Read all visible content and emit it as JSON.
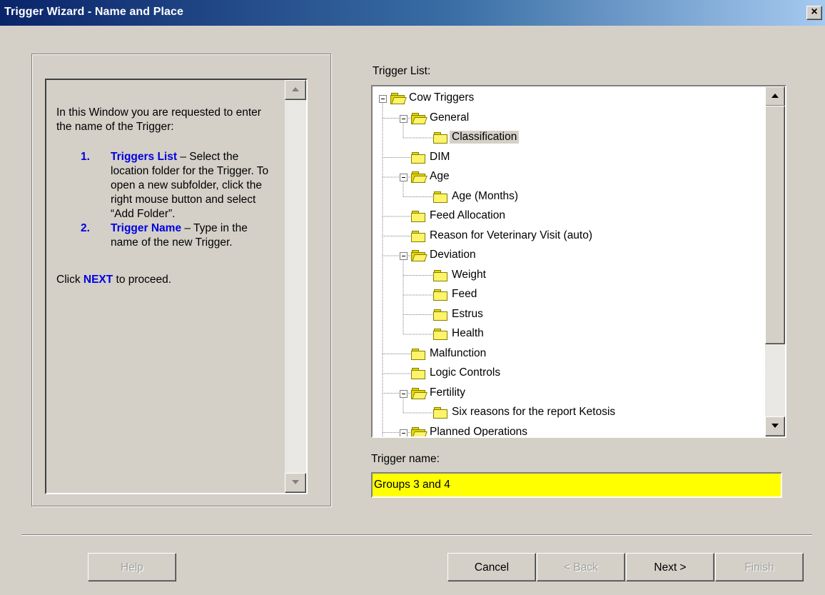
{
  "window": {
    "title": "Trigger Wizard - Name and Place",
    "close_label": "×"
  },
  "help": {
    "intro": "In this Window you are requested to enter the name of the Trigger:",
    "items": [
      {
        "num": "1.",
        "title": "Triggers List",
        "text": " – Select the location folder for the Trigger. To open a new subfolder, click the right mouse button and select “Add Folder”."
      },
      {
        "num": "2.",
        "title": "Trigger Name",
        "text": " – Type in the name of the new Trigger."
      }
    ],
    "proceed_prefix": "Click ",
    "proceed_keyword": "NEXT",
    "proceed_suffix": " to proceed."
  },
  "trigger_list": {
    "label": "Trigger List:",
    "nodes": [
      {
        "label": "Cow Triggers",
        "level": 0,
        "expanded": true,
        "selected": false
      },
      {
        "label": "General",
        "level": 1,
        "expanded": true,
        "selected": false
      },
      {
        "label": "Classification",
        "level": 2,
        "expanded": false,
        "selected": true
      },
      {
        "label": "DIM",
        "level": 1,
        "expanded": false,
        "selected": false
      },
      {
        "label": "Age",
        "level": 1,
        "expanded": true,
        "selected": false
      },
      {
        "label": "Age (Months)",
        "level": 2,
        "expanded": false,
        "selected": false
      },
      {
        "label": "Feed Allocation",
        "level": 1,
        "expanded": false,
        "selected": false
      },
      {
        "label": "Reason for Veterinary Visit (auto)",
        "level": 1,
        "expanded": false,
        "selected": false
      },
      {
        "label": "Deviation",
        "level": 1,
        "expanded": true,
        "selected": false
      },
      {
        "label": "Weight",
        "level": 2,
        "expanded": false,
        "selected": false
      },
      {
        "label": "Feed",
        "level": 2,
        "expanded": false,
        "selected": false
      },
      {
        "label": "Estrus",
        "level": 2,
        "expanded": false,
        "selected": false
      },
      {
        "label": "Health",
        "level": 2,
        "expanded": false,
        "selected": false
      },
      {
        "label": "Malfunction",
        "level": 1,
        "expanded": false,
        "selected": false
      },
      {
        "label": "Logic Controls",
        "level": 1,
        "expanded": false,
        "selected": false
      },
      {
        "label": "Fertility",
        "level": 1,
        "expanded": true,
        "selected": false
      },
      {
        "label": "Six reasons for the report Ketosis",
        "level": 2,
        "expanded": false,
        "selected": false
      },
      {
        "label": "Planned Operations",
        "level": 1,
        "expanded": true,
        "selected": false
      }
    ]
  },
  "trigger_name": {
    "label": "Trigger name:",
    "value": "Groups 3 and 4"
  },
  "buttons": {
    "help": "Help",
    "cancel": "Cancel",
    "back": "< Back",
    "next": "Next >",
    "finish": "Finish"
  },
  "colors": {
    "title_gradient_start": "#0a246a",
    "title_gradient_end": "#a6caf0",
    "input_bg": "#ffff00",
    "help_accent": "#0000e0",
    "dialog_bg": "#d4d0c8"
  }
}
